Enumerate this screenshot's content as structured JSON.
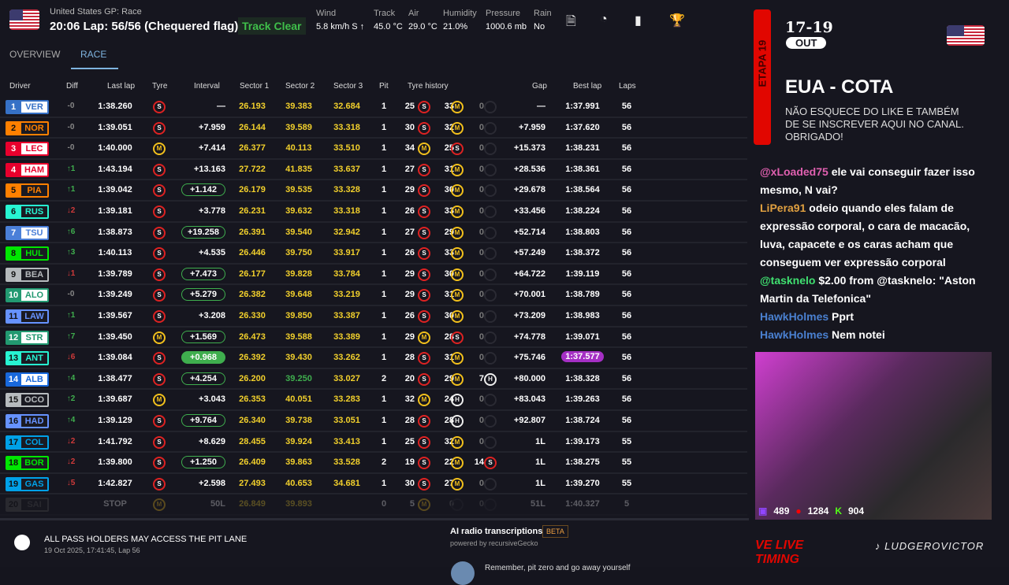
{
  "header": {
    "session": "United States GP: Race",
    "title": "20:06 Lap: 56/56 (Chequered flag)",
    "status": "Track Clear",
    "weather": [
      {
        "label": "Wind",
        "value": "5.8 km/h S ↑"
      },
      {
        "label": "Track",
        "value": "45.0 °C"
      },
      {
        "label": "Air",
        "value": "29.0 °C"
      },
      {
        "label": "Humidity",
        "value": "21.0%"
      },
      {
        "label": "Pressure",
        "value": "1000.6 mb"
      },
      {
        "label": "Rain",
        "value": "No"
      }
    ],
    "icons": [
      "document-search-icon",
      "speedometer-icon",
      "bar-chart-icon",
      "trophy-icon"
    ]
  },
  "tabs": [
    "OVERVIEW",
    "RACE"
  ],
  "columns": [
    "Driver",
    "Diff",
    "Last lap",
    "Tyre",
    "Interval",
    "Sector 1",
    "Sector 2",
    "Sector 3",
    "Pit",
    "Tyre history",
    "Gap",
    "Best lap",
    "Laps"
  ],
  "rows": [
    {
      "pos": "1",
      "code": "VER",
      "color": "#3671C6",
      "light": true,
      "diff": "-0",
      "last": "1:38.260",
      "tyre": "S",
      "int": "—",
      "ib": 0,
      "s1": "26.193",
      "s2": "39.383",
      "s3": "32.684",
      "pit": "1",
      "hist": [
        [
          "25",
          "S"
        ],
        [
          "33",
          "M"
        ],
        [
          "0",
          "E"
        ]
      ],
      "gap": "—",
      "best": "1:37.991",
      "laps": "56"
    },
    {
      "pos": "2",
      "code": "NOR",
      "color": "#FF8000",
      "light": false,
      "diff": "-0",
      "last": "1:39.051",
      "tyre": "S",
      "int": "+7.959",
      "ib": 0,
      "s1": "26.144",
      "s2": "39.589",
      "s3": "33.318",
      "pit": "1",
      "hist": [
        [
          "30",
          "S"
        ],
        [
          "32",
          "M"
        ],
        [
          "0",
          "E"
        ]
      ],
      "gap": "+7.959",
      "best": "1:37.620",
      "laps": "56"
    },
    {
      "pos": "3",
      "code": "LEC",
      "color": "#E8002D",
      "light": true,
      "diff": "-0",
      "last": "1:40.000",
      "tyre": "M",
      "int": "+7.414",
      "ib": 0,
      "s1": "26.377",
      "s2": "40.113",
      "s3": "33.510",
      "pit": "1",
      "hist": [
        [
          "34",
          "M"
        ],
        [
          "25",
          "S"
        ],
        [
          "0",
          "E"
        ]
      ],
      "gap": "+15.373",
      "best": "1:38.231",
      "laps": "56"
    },
    {
      "pos": "4",
      "code": "HAM",
      "color": "#E8002D",
      "light": true,
      "diff": "↑1",
      "last": "1:43.194",
      "tyre": "S",
      "int": "+13.163",
      "ib": 0,
      "s1": "27.722",
      "s2": "41.835",
      "s3": "33.637",
      "pit": "1",
      "hist": [
        [
          "27",
          "S"
        ],
        [
          "31",
          "M"
        ],
        [
          "0",
          "E"
        ]
      ],
      "gap": "+28.536",
      "best": "1:38.361",
      "laps": "56"
    },
    {
      "pos": "5",
      "code": "PIA",
      "color": "#FF8000",
      "light": false,
      "diff": "↑1",
      "last": "1:39.042",
      "tyre": "S",
      "int": "+1.142",
      "ib": 1,
      "s1": "26.179",
      "s2": "39.535",
      "s3": "33.328",
      "pit": "1",
      "hist": [
        [
          "29",
          "S"
        ],
        [
          "30",
          "M"
        ],
        [
          "0",
          "E"
        ]
      ],
      "gap": "+29.678",
      "best": "1:38.564",
      "laps": "56"
    },
    {
      "pos": "6",
      "code": "RUS",
      "color": "#27F4D2",
      "light": false,
      "diff": "↓2",
      "last": "1:39.181",
      "tyre": "S",
      "int": "+3.778",
      "ib": 0,
      "s1": "26.231",
      "s2": "39.632",
      "s3": "33.318",
      "pit": "1",
      "hist": [
        [
          "26",
          "S"
        ],
        [
          "33",
          "M"
        ],
        [
          "0",
          "E"
        ]
      ],
      "gap": "+33.456",
      "best": "1:38.224",
      "laps": "56"
    },
    {
      "pos": "7",
      "code": "TSU",
      "color": "#4a7fd8",
      "light": true,
      "diff": "↑6",
      "last": "1:38.873",
      "tyre": "S",
      "int": "+19.258",
      "ib": 1,
      "s1": "26.391",
      "s2": "39.540",
      "s3": "32.942",
      "pit": "1",
      "hist": [
        [
          "27",
          "S"
        ],
        [
          "29",
          "M"
        ],
        [
          "0",
          "E"
        ]
      ],
      "gap": "+52.714",
      "best": "1:38.803",
      "laps": "56"
    },
    {
      "pos": "8",
      "code": "HUL",
      "color": "#00E701",
      "light": false,
      "diff": "↑3",
      "last": "1:40.113",
      "tyre": "S",
      "int": "+4.535",
      "ib": 0,
      "s1": "26.446",
      "s2": "39.750",
      "s3": "33.917",
      "pit": "1",
      "hist": [
        [
          "26",
          "S"
        ],
        [
          "33",
          "M"
        ],
        [
          "0",
          "E"
        ]
      ],
      "gap": "+57.249",
      "best": "1:38.372",
      "laps": "56"
    },
    {
      "pos": "9",
      "code": "BEA",
      "color": "#B6BABD",
      "light": false,
      "diff": "↓1",
      "last": "1:39.789",
      "tyre": "S",
      "int": "+7.473",
      "ib": 1,
      "s1": "26.177",
      "s2": "39.828",
      "s3": "33.784",
      "pit": "1",
      "hist": [
        [
          "29",
          "S"
        ],
        [
          "30",
          "M"
        ],
        [
          "0",
          "E"
        ]
      ],
      "gap": "+64.722",
      "best": "1:39.119",
      "laps": "56"
    },
    {
      "pos": "10",
      "code": "ALO",
      "color": "#229971",
      "light": true,
      "diff": "-0",
      "last": "1:39.249",
      "tyre": "S",
      "int": "+5.279",
      "ib": 1,
      "s1": "26.382",
      "s2": "39.648",
      "s3": "33.219",
      "pit": "1",
      "hist": [
        [
          "29",
          "S"
        ],
        [
          "31",
          "M"
        ],
        [
          "0",
          "E"
        ]
      ],
      "gap": "+70.001",
      "best": "1:38.789",
      "laps": "56"
    },
    {
      "pos": "11",
      "code": "LAW",
      "color": "#6692FF",
      "light": false,
      "diff": "↑1",
      "last": "1:39.567",
      "tyre": "S",
      "int": "+3.208",
      "ib": 0,
      "s1": "26.330",
      "s2": "39.850",
      "s3": "33.387",
      "pit": "1",
      "hist": [
        [
          "26",
          "S"
        ],
        [
          "30",
          "M"
        ],
        [
          "0",
          "E"
        ]
      ],
      "gap": "+73.209",
      "best": "1:38.983",
      "laps": "56"
    },
    {
      "pos": "12",
      "code": "STR",
      "color": "#229971",
      "light": true,
      "diff": "↑7",
      "last": "1:39.450",
      "tyre": "M",
      "int": "+1.569",
      "ib": 1,
      "s1": "26.473",
      "s2": "39.588",
      "s3": "33.389",
      "pit": "1",
      "hist": [
        [
          "29",
          "M"
        ],
        [
          "28",
          "S"
        ],
        [
          "0",
          "E"
        ]
      ],
      "gap": "+74.778",
      "best": "1:39.071",
      "laps": "56"
    },
    {
      "pos": "13",
      "code": "ANT",
      "color": "#27F4D2",
      "light": false,
      "diff": "↓6",
      "last": "1:39.084",
      "tyre": "S",
      "int": "+0.968",
      "ib": 2,
      "s1": "26.392",
      "s2": "39.430",
      "s3": "33.262",
      "pit": "1",
      "hist": [
        [
          "28",
          "S"
        ],
        [
          "31",
          "M"
        ],
        [
          "0",
          "E"
        ]
      ],
      "gap": "+75.746",
      "best": "1:37.577",
      "bestp": true,
      "laps": "56"
    },
    {
      "pos": "14",
      "code": "ALB",
      "color": "#1868DB",
      "light": true,
      "diff": "↑4",
      "last": "1:38.477",
      "tyre": "S",
      "int": "+4.254",
      "ib": 1,
      "s1": "26.200",
      "s2": "39.250",
      "s2g": true,
      "s3": "33.027",
      "pit": "2",
      "hist": [
        [
          "20",
          "S"
        ],
        [
          "29",
          "M"
        ],
        [
          "7",
          "H"
        ]
      ],
      "gap": "+80.000",
      "best": "1:38.328",
      "laps": "56"
    },
    {
      "pos": "15",
      "code": "OCO",
      "color": "#B6BABD",
      "light": false,
      "diff": "↑2",
      "last": "1:39.687",
      "tyre": "M",
      "int": "+3.043",
      "ib": 0,
      "s1": "26.353",
      "s2": "40.051",
      "s3": "33.283",
      "pit": "1",
      "hist": [
        [
          "32",
          "M"
        ],
        [
          "24",
          "H"
        ],
        [
          "0",
          "E"
        ]
      ],
      "gap": "+83.043",
      "best": "1:39.263",
      "laps": "56"
    },
    {
      "pos": "16",
      "code": "HAD",
      "color": "#6692FF",
      "light": false,
      "diff": "↑4",
      "last": "1:39.129",
      "tyre": "S",
      "int": "+9.764",
      "ib": 1,
      "s1": "26.340",
      "s2": "39.738",
      "s3": "33.051",
      "pit": "1",
      "hist": [
        [
          "28",
          "S"
        ],
        [
          "28",
          "H"
        ],
        [
          "0",
          "E"
        ]
      ],
      "gap": "+92.807",
      "best": "1:38.724",
      "laps": "56"
    },
    {
      "pos": "17",
      "code": "COL",
      "color": "#00A1E8",
      "light": false,
      "diff": "↓2",
      "last": "1:41.792",
      "tyre": "S",
      "int": "+8.629",
      "ib": 0,
      "s1": "28.455",
      "s2": "39.924",
      "s3": "33.413",
      "pit": "1",
      "hist": [
        [
          "25",
          "S"
        ],
        [
          "32",
          "M"
        ],
        [
          "0",
          "E"
        ]
      ],
      "gap": "1L",
      "best": "1:39.173",
      "laps": "55"
    },
    {
      "pos": "18",
      "code": "BOR",
      "color": "#00E701",
      "light": false,
      "diff": "↓2",
      "last": "1:39.800",
      "tyre": "S",
      "int": "+1.250",
      "ib": 1,
      "s1": "26.409",
      "s2": "39.863",
      "s3": "33.528",
      "pit": "2",
      "hist": [
        [
          "19",
          "S"
        ],
        [
          "22",
          "M"
        ],
        [
          "14",
          "S"
        ]
      ],
      "gap": "1L",
      "best": "1:38.275",
      "laps": "55"
    },
    {
      "pos": "19",
      "code": "GAS",
      "color": "#00A1E8",
      "light": false,
      "diff": "↓5",
      "last": "1:42.827",
      "tyre": "S",
      "int": "+2.598",
      "ib": 0,
      "s1": "27.493",
      "s2": "40.653",
      "s3": "34.681",
      "pit": "1",
      "hist": [
        [
          "30",
          "S"
        ],
        [
          "27",
          "M"
        ],
        [
          "0",
          "E"
        ]
      ],
      "gap": "1L",
      "best": "1:39.270",
      "laps": "55"
    },
    {
      "pos": "20",
      "code": "SAI",
      "color": "#555",
      "light": false,
      "diff": "",
      "last": "STOP",
      "tyre": "M",
      "int": "50L",
      "ib": 0,
      "s1": "26.849",
      "s2": "39.893",
      "s3": "",
      "pit": "0",
      "hist": [
        [
          "5",
          "M"
        ],
        [
          "0",
          "E"
        ],
        [
          "0",
          "E"
        ]
      ],
      "gap": "51L",
      "best": "1:40.327",
      "laps": "5",
      "dim": true
    }
  ],
  "footer": {
    "message": "ALL PASS HOLDERS MAY ACCESS THE PIT LANE",
    "time": "19 Oct 2025, 17:41:45, Lap 56",
    "radio_title": "AI radio transcriptions",
    "radio_badge": "BETA",
    "radio_sub": "powered by recursiveGecko",
    "radio_msg": "Remember, pit zero and go away yourself"
  },
  "side": {
    "etapa": "ETAPA 19",
    "dates": "17-19",
    "month": "OUT",
    "race": "EUA - COTA",
    "cta": "NÃO ESQUECE DO LIKE E TAMBÉM DE SE INSCREVER AQUI NO CANAL. OBRIGADO!",
    "chat": [
      {
        "user": "@xLoaded75",
        "color": "#e060b0",
        "text": "ele vai conseguir fazer isso mesmo, N vai?"
      },
      {
        "user": "LiPera91",
        "color": "#e0a040",
        "text": "odeio quando eles falam de expressão corporal, o cara de macacão, luva, capacete e os caras acham que conseguem ver expressão corporal"
      },
      {
        "user": "@tasknelo",
        "color": "#40e070",
        "text": "$2.00 from @tasknelo: \"Aston Martin da Telefonica\""
      },
      {
        "user": "HawkHolmes",
        "color": "#4a80d0",
        "text": "Pprt"
      },
      {
        "user": "HawkHolmes",
        "color": "#4a80d0",
        "text": "Nem notei"
      }
    ],
    "viewers": {
      "twitch": "489",
      "youtube": "1284",
      "kick": "904"
    },
    "logo": "VE LIVE TIMING",
    "handle": "LUDGEROVICTOR"
  }
}
